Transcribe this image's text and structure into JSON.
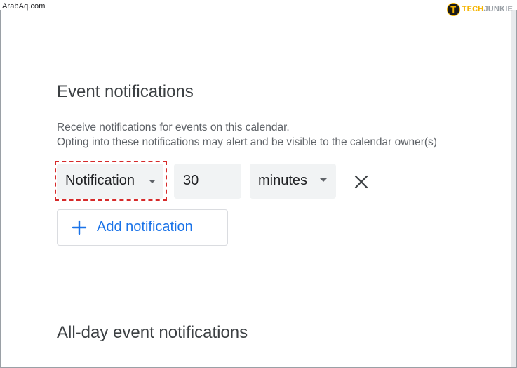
{
  "watermark": "ArabAq.com",
  "brand": {
    "badge_letter": "T",
    "tech": "TECH",
    "junkie": "JUNKIE"
  },
  "event_notifications": {
    "title": "Event notifications",
    "description_line1": "Receive notifications for events on this calendar.",
    "description_line2": "Opting into these notifications may alert and be visible to the calendar owner(s)",
    "row": {
      "type_value": "Notification",
      "amount_value": "30",
      "unit_value": "minutes"
    },
    "add_button_label": "Add notification"
  },
  "allday_notifications": {
    "title": "All-day event notifications"
  },
  "colors": {
    "accent": "#1a73e8",
    "highlight": "#d62a2a",
    "field_bg": "#f1f3f4"
  },
  "icons": {
    "type_caret": "caret-down-icon",
    "unit_caret": "caret-down-icon",
    "remove": "close-icon",
    "add": "plus-icon"
  }
}
